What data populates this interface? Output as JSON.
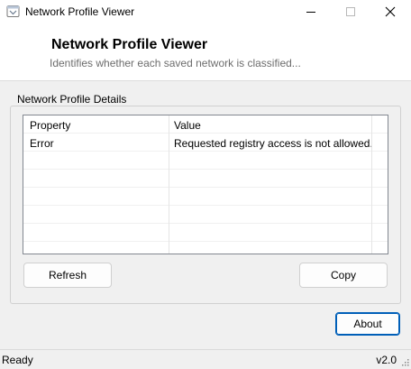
{
  "window": {
    "title": "Network Profile Viewer",
    "icon": "app-window-icon"
  },
  "header": {
    "title": "Network Profile Viewer",
    "subtitle": "Identifies whether each saved network is classified..."
  },
  "group": {
    "label": "Network Profile Details"
  },
  "table": {
    "columns": [
      "Property",
      "Value"
    ],
    "rows": [
      [
        "Error",
        "Requested registry access is not allowed."
      ]
    ]
  },
  "buttons": {
    "refresh": "Refresh",
    "copy": "Copy",
    "about": "About"
  },
  "status": {
    "left": "Ready",
    "right": "v2.0"
  },
  "colors": {
    "accent": "#005fb8",
    "window_bg": "#f0f0f0"
  }
}
